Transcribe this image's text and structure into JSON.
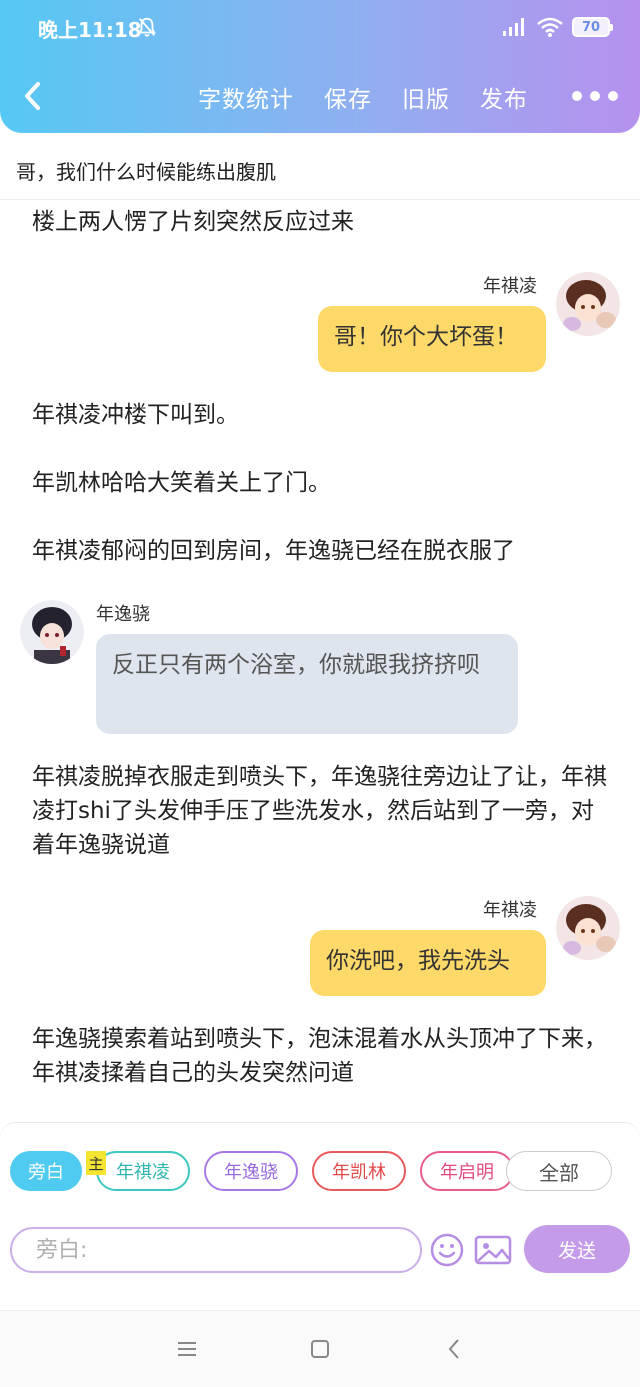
{
  "status_bar": {
    "time": "晚上11:18",
    "battery": "70"
  },
  "nav": {
    "actions": [
      "字数统计",
      "保存",
      "旧版",
      "发布"
    ]
  },
  "title": "哥，我们什么时候能练出腹肌",
  "content": [
    {
      "type": "narration",
      "text": "楼上两人愣了片刻突然反应过来"
    },
    {
      "type": "dialog",
      "side": "right",
      "speaker": "年祺凌",
      "text": "哥！你个大坏蛋！"
    },
    {
      "type": "narration",
      "text": "年祺凌冲楼下叫到。"
    },
    {
      "type": "narration",
      "text": "年凯林哈哈大笑着关上了门。"
    },
    {
      "type": "narration",
      "text": "年祺凌郁闷的回到房间，年逸骁已经在脱衣服了"
    },
    {
      "type": "dialog",
      "side": "left",
      "speaker": "年逸骁",
      "text": "反正只有两个浴室，你就跟我挤挤呗"
    },
    {
      "type": "narration",
      "text": "年祺凌脱掉衣服走到喷头下，年逸骁往旁边让了让，年祺凌打shi了头发伸手压了些洗发水，然后站到了一旁，对着年逸骁说道"
    },
    {
      "type": "dialog",
      "side": "right",
      "speaker": "年祺凌",
      "text": "你洗吧，我先洗头"
    },
    {
      "type": "narration",
      "text": "年逸骁摸索着站到喷头下，泡沫混着水从头顶冲了下来，年祺凌揉着自己的头发突然问道"
    }
  ],
  "characters": {
    "narrator": "旁白",
    "main_tag": "主",
    "items": [
      "年祺凌",
      "年逸骁",
      "年凯林",
      "年启明"
    ],
    "all_label": "全部"
  },
  "composer": {
    "placeholder": "旁白:",
    "send_label": "发送"
  },
  "colors": {
    "header_gradient": [
      "#55c8f3",
      "#b691ee"
    ],
    "bubble_right": "#fdd96a",
    "bubble_left": "#dfe5ee",
    "send_button": "#c49be8"
  }
}
